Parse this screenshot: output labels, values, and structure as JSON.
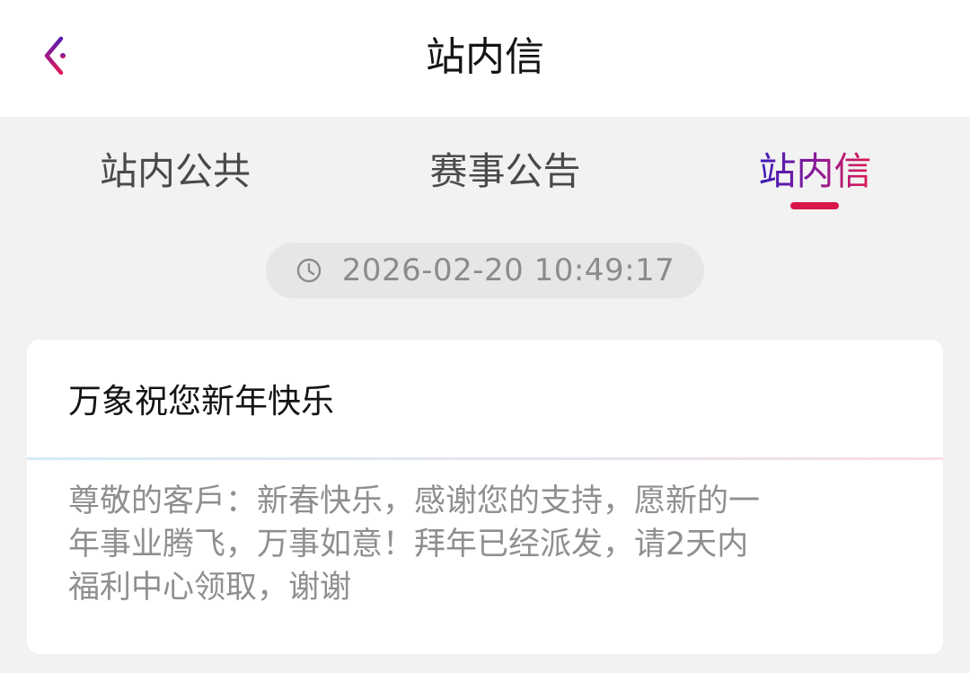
{
  "header": {
    "title": "站内信",
    "back_icon": "chevron-left-icon",
    "back_icon_colors": [
      "#5b1bb0",
      "#e0185a"
    ]
  },
  "tabs": [
    {
      "label": "站内公共",
      "active": false
    },
    {
      "label": "赛事公告",
      "active": false
    },
    {
      "label": "站内信",
      "active": true
    }
  ],
  "accent": {
    "underline_color": "#d9154a",
    "gradient": [
      "#3a1bb8",
      "#8a1a9a",
      "#e01a4f"
    ]
  },
  "message": {
    "timestamp": "2026-02-20 10:49:17",
    "clock_icon": "clock-icon",
    "title": "万象祝您新年快乐",
    "body_lines": [
      "尊敬的客戶：新春快乐，感谢您的支持，愿新的一",
      "年事业腾飞，万事如意！拜年已经派发，请2天内",
      "福利中心领取，谢谢"
    ]
  }
}
